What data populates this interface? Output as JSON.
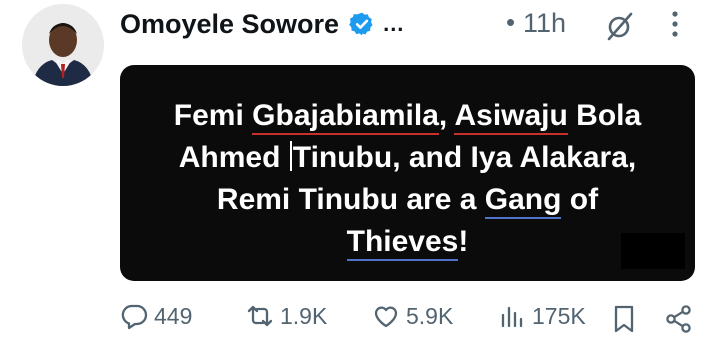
{
  "post": {
    "author_name": "Omoyele Sowore",
    "more_glyph": "...",
    "separator": "•",
    "time": "11h"
  },
  "card": {
    "line1": {
      "a": "Femi ",
      "b": "Gbajabiamila",
      "c": ", ",
      "d": "Asiwaju",
      "e": " Bola"
    },
    "line2": {
      "a": "Ahmed ",
      "b": "Tinubu, and Iya Alakara,"
    },
    "line3": {
      "a": "Remi Tinubu are a ",
      "b": "Gang",
      "c": " of"
    },
    "line4": {
      "a": "Thieves",
      "b": "!"
    }
  },
  "actions": {
    "replies": "449",
    "reposts": "1.9K",
    "likes": "5.9K",
    "views": "175K"
  },
  "colors": {
    "verified": "#1d9bf0",
    "underline_red": "#c8312b",
    "underline_blue": "#4e73c9",
    "secondary_text": "#536471"
  },
  "icons": [
    "verified-badge-icon",
    "mute-icon",
    "more-options-icon",
    "reply-icon",
    "repost-icon",
    "like-icon",
    "views-icon",
    "bookmark-icon",
    "share-icon"
  ]
}
